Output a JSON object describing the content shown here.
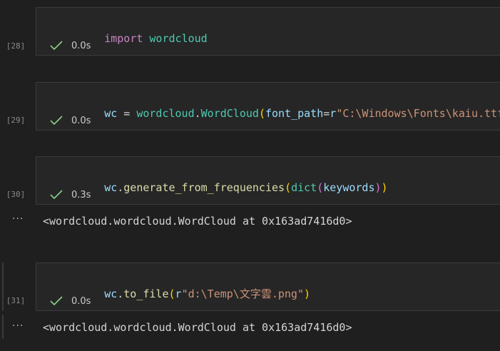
{
  "cells": [
    {
      "exec_count": "[28]",
      "status_time": "0.0s",
      "code": {
        "t1": "import",
        "t2": " ",
        "t3": "wordcloud"
      }
    },
    {
      "exec_count": "[29]",
      "status_time": "0.0s",
      "code": {
        "t1": "wc",
        "t2": " = ",
        "t3": "wordcloud",
        "t4": ".",
        "t5": "WordCloud",
        "t6": "(",
        "t7": "font_path",
        "t8": "=",
        "t9": "r",
        "t10": "\"C:\\Windows\\Fonts\\kaiu.ttf\"",
        "t11": ")"
      }
    },
    {
      "exec_count": "[30]",
      "status_time": "0.3s",
      "code": {
        "t1": "wc",
        "t2": ".",
        "t3": "generate_from_frequencies",
        "t4": "(",
        "t5": "dict",
        "t6": "(",
        "t7": "keywords",
        "t8": ")",
        "t9": ")"
      },
      "output": "<wordcloud.wordcloud.WordCloud at 0x163ad7416d0>"
    },
    {
      "exec_count": "[31]",
      "status_time": "0.0s",
      "code": {
        "t1": "wc",
        "t2": ".",
        "t3": "to_file",
        "t4": "(",
        "t5": "r",
        "t6": "\"d:\\Temp\\文字雲.png\"",
        "t7": ")"
      },
      "output": "<wordcloud.wordcloud.WordCloud at 0x163ad7416d0>"
    }
  ],
  "ellipsis_label": "···",
  "colors": {
    "keyword": "#c586c0",
    "module": "#4ec9b0",
    "variable": "#9cdcfe",
    "function": "#dcdcaa",
    "string": "#ce9178",
    "check": "#89d185"
  },
  "icons": [
    "check-icon",
    "ellipsis-icon"
  ]
}
